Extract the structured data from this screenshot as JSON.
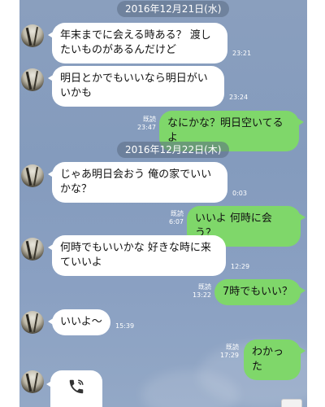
{
  "chat": {
    "date1": "2016年12月21日(水)",
    "date2": "2016年12月22日(木)",
    "read_label": "既読",
    "messages": [
      {
        "side": "in",
        "text": "年末までに会える時ある？ 渡したいものがあるんだけど",
        "time": "23:21"
      },
      {
        "side": "in",
        "text": "明日とかでもいいなら明日がいいかも",
        "time": "23:24"
      },
      {
        "side": "out",
        "text": "なにかな？明日空いてるよ",
        "time": "23:47"
      },
      {
        "side": "in",
        "text": "じゃあ明日会おう 俺の家でいいかな？",
        "time": "0:03"
      },
      {
        "side": "out",
        "text": "いいよ 何時に会う？",
        "time": "6:07"
      },
      {
        "side": "in",
        "text": "何時でもいいかな 好きな時に来ていいよ",
        "time": "12:29"
      },
      {
        "side": "out",
        "text": "7時でもいい？",
        "time": "13:22"
      },
      {
        "side": "in",
        "text": "いいよ〜",
        "time": "15:39"
      },
      {
        "side": "out",
        "text": "わかった",
        "time": "17:29"
      }
    ],
    "call_icon": "phone-icon"
  }
}
